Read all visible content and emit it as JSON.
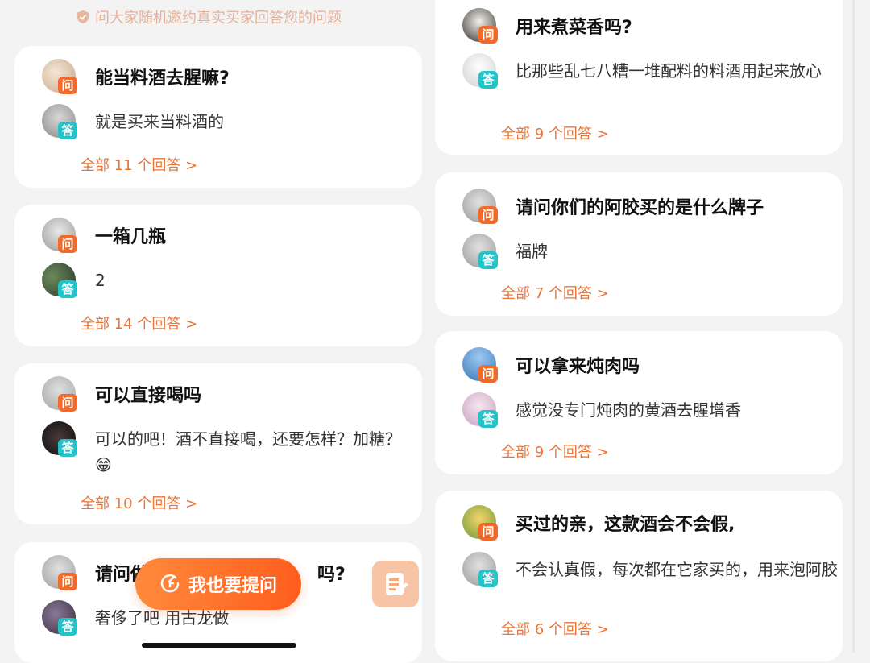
{
  "notice": "问大家随机邀约真实买家回答您的问题",
  "left": [
    {
      "q": "能当料酒去腥嘛?",
      "a": "就是买来当料酒的",
      "more": "全部 11 个回答 >"
    },
    {
      "q": "一箱几瓶",
      "a": "2",
      "more": "全部 14 个回答 >"
    },
    {
      "q": "可以直接喝吗",
      "a": "可以的吧！酒不直接喝，还要怎样？加糖？😁",
      "more": "全部 10 个回答 >"
    },
    {
      "q": "请问做",
      "q_tail": "吗?",
      "a": "奢侈了吧 用古龙做"
    }
  ],
  "right": [
    {
      "q": "用来煮菜香吗?",
      "a": "比那些乱七八糟一堆配料的料酒用起来放心",
      "more": "全部 9 个回答 >"
    },
    {
      "q": "请问你们的阿胶买的是什么牌子",
      "a": "福牌",
      "more": "全部 7 个回答 >"
    },
    {
      "q": "可以拿来炖肉吗",
      "a": "感觉没专门炖肉的黄酒去腥增香",
      "more": "全部 9 个回答 >"
    },
    {
      "q": "买过的亲，这款酒会不会假,",
      "a": "不会认真假，每次都在它家买的，用来泡阿胶",
      "more": "全部 6 个回答 >"
    }
  ],
  "tags": {
    "q": "问",
    "a": "答"
  },
  "ask_button": "我也要提问",
  "colors": {
    "accent": "#f26a2a",
    "answer": "#22c3c9",
    "link": "#e8753a"
  }
}
